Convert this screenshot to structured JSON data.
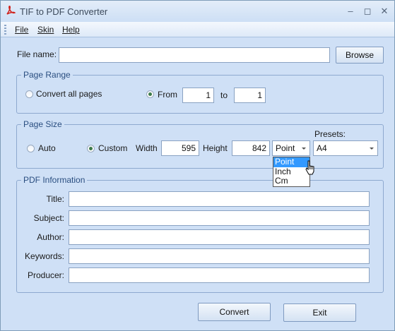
{
  "window": {
    "title": "TIF to PDF Converter",
    "accent_color": "#cfe0f6",
    "icon": "pdf-icon",
    "controls": [
      "minimize-icon",
      "maximize-icon",
      "close-icon"
    ]
  },
  "menu": {
    "items": [
      {
        "label": "File"
      },
      {
        "label": "Skin"
      },
      {
        "label": "Help"
      }
    ]
  },
  "file": {
    "label": "File name:",
    "value": "",
    "browse_label": "Browse"
  },
  "page_range": {
    "title": "Page Range",
    "convert_all_label": "Convert all pages",
    "from_label": "From",
    "from_value": "1",
    "to_label": "to",
    "to_value": "1",
    "selected": "from"
  },
  "page_size": {
    "title": "Page Size",
    "auto_label": "Auto",
    "custom_label": "Custom",
    "selected": "custom",
    "width_label": "Width",
    "width_value": "595",
    "height_label": "Height",
    "height_value": "842",
    "unit_value": "Point",
    "unit_options": [
      "Point",
      "Inch",
      "Cm"
    ],
    "unit_highlighted": "Point",
    "presets_label": "Presets:",
    "presets_value": "A4"
  },
  "pdf_info": {
    "title": "PDF Information",
    "fields": [
      {
        "label": "Title:",
        "value": ""
      },
      {
        "label": "Subject:",
        "value": ""
      },
      {
        "label": "Author:",
        "value": ""
      },
      {
        "label": "Keywords:",
        "value": ""
      },
      {
        "label": "Producer:",
        "value": ""
      }
    ]
  },
  "actions": {
    "convert_label": "Convert",
    "exit_label": "Exit"
  }
}
